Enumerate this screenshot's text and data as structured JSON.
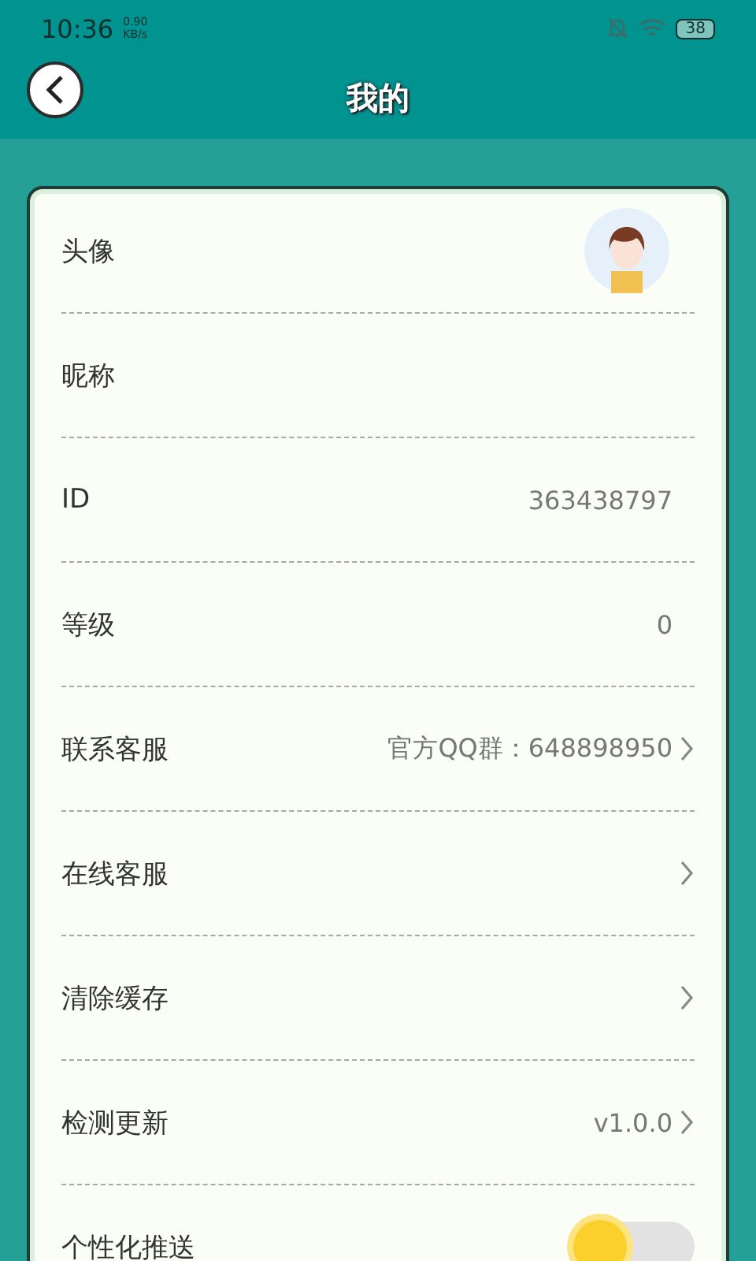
{
  "status_bar": {
    "time": "10:36",
    "speed_value": "0.90",
    "speed_unit": "KB/s",
    "battery": "38"
  },
  "header": {
    "title": "我的"
  },
  "rows": [
    {
      "kind": "avatar",
      "label": "头像"
    },
    {
      "kind": "text",
      "label": "昵称",
      "arrow": false
    },
    {
      "kind": "text",
      "label": "ID",
      "value": "363438797",
      "arrow": false
    },
    {
      "kind": "text",
      "label": "等级",
      "value": "0",
      "arrow": false
    },
    {
      "kind": "text",
      "label": "联系客服",
      "value": "官方QQ群：648898950",
      "arrow": true
    },
    {
      "kind": "text",
      "label": "在线客服",
      "arrow": true
    },
    {
      "kind": "text",
      "label": "清除缓存",
      "arrow": true
    },
    {
      "kind": "text",
      "label": "检测更新",
      "value": "v1.0.0",
      "arrow": true
    },
    {
      "kind": "switch",
      "label": "个性化推送",
      "on": false
    }
  ]
}
